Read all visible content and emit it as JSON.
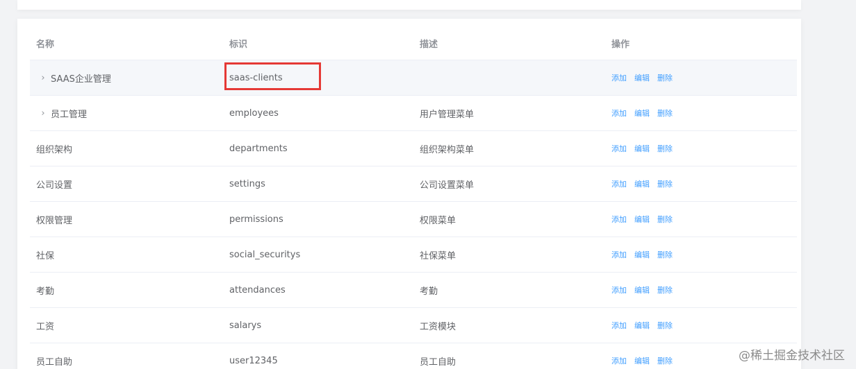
{
  "table": {
    "headers": {
      "name": "名称",
      "code": "标识",
      "desc": "描述",
      "ops": "操作"
    },
    "rows": [
      {
        "name": "SAAS企业管理",
        "code": "saas-clients",
        "desc": "",
        "expandable": true
      },
      {
        "name": "员工管理",
        "code": "employees",
        "desc": "用户管理菜单",
        "expandable": true
      },
      {
        "name": "组织架构",
        "code": "departments",
        "desc": "组织架构菜单",
        "expandable": false
      },
      {
        "name": "公司设置",
        "code": "settings",
        "desc": "公司设置菜单",
        "expandable": false
      },
      {
        "name": "权限管理",
        "code": "permissions",
        "desc": "权限菜单",
        "expandable": false
      },
      {
        "name": "社保",
        "code": "social_securitys",
        "desc": "社保菜单",
        "expandable": false
      },
      {
        "name": "考勤",
        "code": "attendances",
        "desc": "考勤",
        "expandable": false
      },
      {
        "name": "工资",
        "code": "salarys",
        "desc": "工资模块",
        "expandable": false
      },
      {
        "name": "员工自助",
        "code": "user12345",
        "desc": "员工自助",
        "expandable": false
      }
    ],
    "actions": {
      "add": "添加",
      "edit": "编辑",
      "delete": "删除"
    },
    "expand_icon": "›"
  },
  "watermark": "@稀土掘金技术社区",
  "colors": {
    "link": "#409eff",
    "highlight": "#e53935"
  }
}
